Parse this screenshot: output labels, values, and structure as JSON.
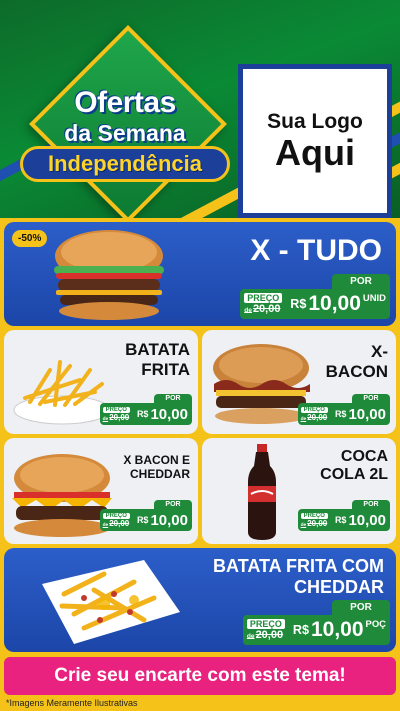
{
  "header": {
    "title_line1": "Ofertas",
    "title_line2": "da Semana",
    "title_small": "da",
    "title_line3": "Independência",
    "logo_line1": "Sua Logo",
    "logo_line2": "Aqui"
  },
  "products": [
    {
      "name": "X - TUDO",
      "discount": "-50%",
      "por": "POR",
      "preco": "PREÇO",
      "old_prefix": "de",
      "old": "20,00",
      "currency": "R$",
      "price": "10,00",
      "unit": "UNID"
    },
    {
      "name": "BATATA FRITA",
      "por": "POR",
      "preco": "PREÇO",
      "old_prefix": "de",
      "old": "20,00",
      "currency": "R$",
      "price": "10,00"
    },
    {
      "name": "X- BACON",
      "por": "POR",
      "preco": "PREÇO",
      "old_prefix": "de",
      "old": "20,00",
      "currency": "R$",
      "price": "10,00"
    },
    {
      "name": "X BACON E CHEDDAR",
      "por": "POR",
      "preco": "PREÇO",
      "old_prefix": "de",
      "old": "20,00",
      "currency": "R$",
      "price": "10,00"
    },
    {
      "name": "COCA COLA 2L",
      "por": "POR",
      "preco": "PREÇO",
      "old_prefix": "de",
      "old": "20,00",
      "currency": "R$",
      "price": "10,00"
    },
    {
      "name": "BATATA FRITA COM CHEDDAR",
      "por": "POR",
      "preco": "PREÇO",
      "old_prefix": "de",
      "old": "20,00",
      "currency": "R$",
      "price": "10,00",
      "unit": "POÇ"
    }
  ],
  "cta": "Crie seu encarte com este tema!",
  "disclaimer": "*Imagens Meramente Ilustrativas",
  "colors": {
    "green": "#0a8a35",
    "blue": "#1c46a8",
    "yellow": "#f5c21a",
    "pink": "#e8227e"
  }
}
